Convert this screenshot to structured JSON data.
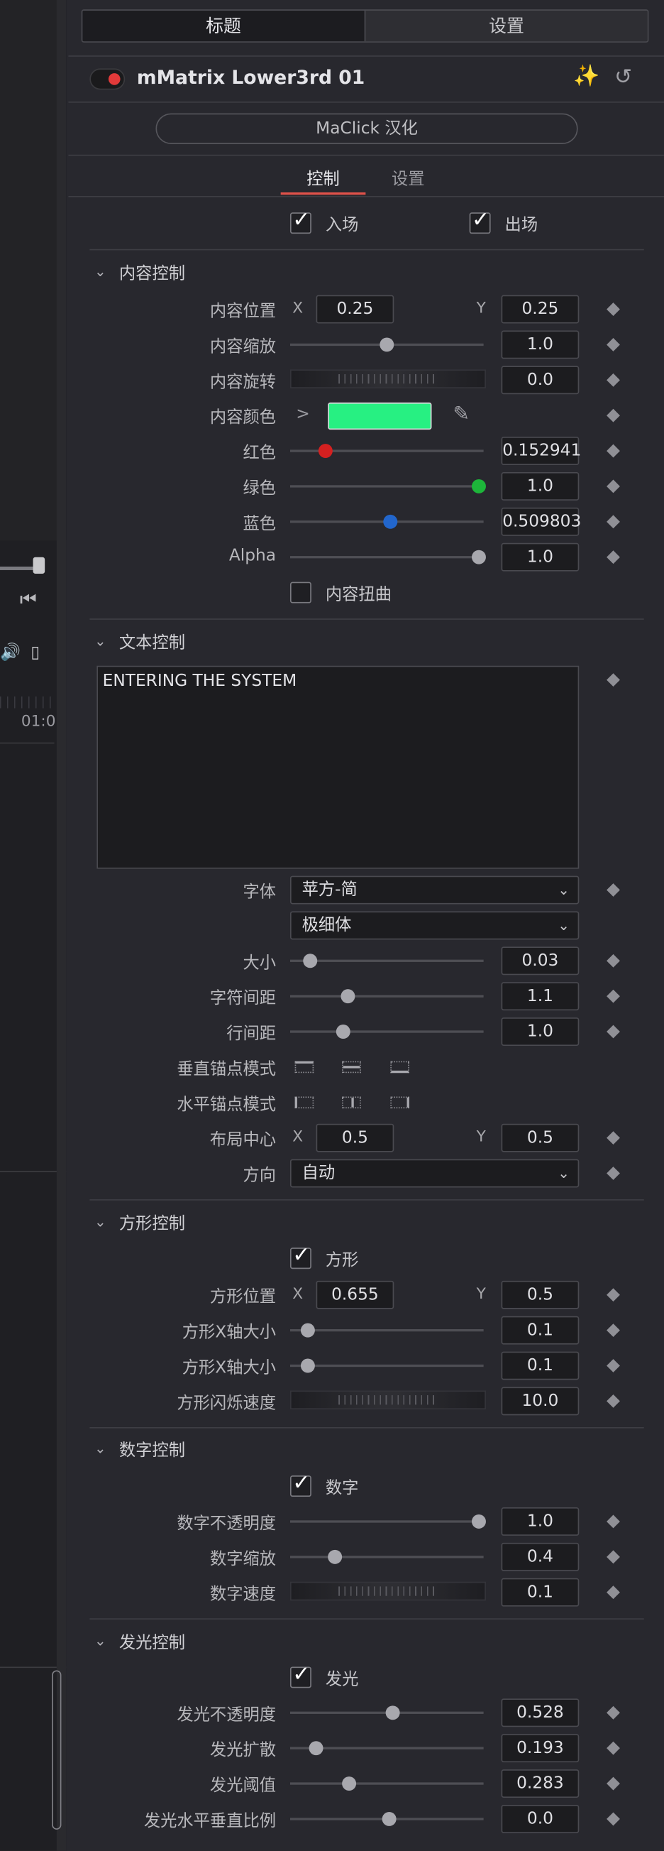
{
  "timeline": {
    "time_label": "01:0"
  },
  "tabs": {
    "title": "标题",
    "settings": "设置"
  },
  "node": {
    "name": "mMatrix Lower3rd 01",
    "toggle_color": "#e23a3a"
  },
  "maclick_button": "MaClick 汉化",
  "subtabs": {
    "control": "控制",
    "settings": "设置"
  },
  "in_out": {
    "in_label": "入场",
    "in_checked": true,
    "out_label": "出场",
    "out_checked": true
  },
  "content": {
    "title": "内容控制",
    "position_label": "内容位置",
    "x_label": "X",
    "x": "0.25",
    "y_label": "Y",
    "y": "0.25",
    "scale_label": "内容缩放",
    "scale": "1.0",
    "scale_level": 0.5,
    "rotation_label": "内容旋转",
    "rotation": "0.0",
    "color_label": "内容颜色",
    "color_hex": "#27f082",
    "red_label": "红色",
    "red": "0.152941",
    "red_color": "#d42020",
    "green_label": "绿色",
    "green": "1.0",
    "green_color": "#1db53a",
    "blue_label": "蓝色",
    "blue": "0.509803",
    "blue_color": "#2266cc",
    "alpha_label": "Alpha",
    "alpha": "1.0",
    "distort_label": "内容扭曲",
    "distort_checked": false
  },
  "text": {
    "title": "文本控制",
    "value": "ENTERING THE SYSTEM",
    "font_label": "字体",
    "font": "苹方-简",
    "weight": "极细体",
    "size_label": "大小",
    "size": "0.03",
    "size_level": 0.03,
    "tracking_label": "字符间距",
    "tracking": "1.1",
    "tracking_level": 0.3,
    "leading_label": "行间距",
    "leading": "1.0",
    "leading_level": 0.27,
    "v_anchor_label": "垂直锚点模式",
    "h_anchor_label": "水平锚点模式",
    "center_label": "布局中心",
    "x_label": "X",
    "cx": "0.5",
    "y_label": "Y",
    "cy": "0.5",
    "direction_label": "方向",
    "direction": "自动"
  },
  "rect": {
    "title": "方形控制",
    "enable_label": "方形",
    "enable_checked": true,
    "position_label": "方形位置",
    "x_label": "X",
    "x": "0.655",
    "y_label": "Y",
    "y": "0.5",
    "xsize_label": "方形X轴大小",
    "xsize": "0.1",
    "xsize_level": 0.05,
    "ysize_label": "方形X轴大小",
    "ysize": "0.1",
    "ysize_level": 0.05,
    "blink_label": "方形闪烁速度",
    "blink": "10.0"
  },
  "digits": {
    "title": "数字控制",
    "enable_label": "数字",
    "enable_checked": true,
    "opacity_label": "数字不透明度",
    "opacity": "1.0",
    "opacity_level": 1.0,
    "scale_label": "数字缩放",
    "scale": "0.4",
    "scale_level": 0.22,
    "speed_label": "数字速度",
    "speed": "0.1"
  },
  "glow": {
    "title": "发光控制",
    "enable_label": "发光",
    "enable_checked": true,
    "opacity_label": "发光不透明度",
    "opacity": "0.528",
    "opacity_level": 0.53,
    "spread_label": "发光扩散",
    "spread": "0.193",
    "spread_level": 0.12,
    "threshold_label": "发光阈值",
    "threshold": "0.283",
    "threshold_level": 0.3,
    "ratio_label": "发光水平垂直比例",
    "ratio": "0.0",
    "ratio_level": 0.5
  }
}
